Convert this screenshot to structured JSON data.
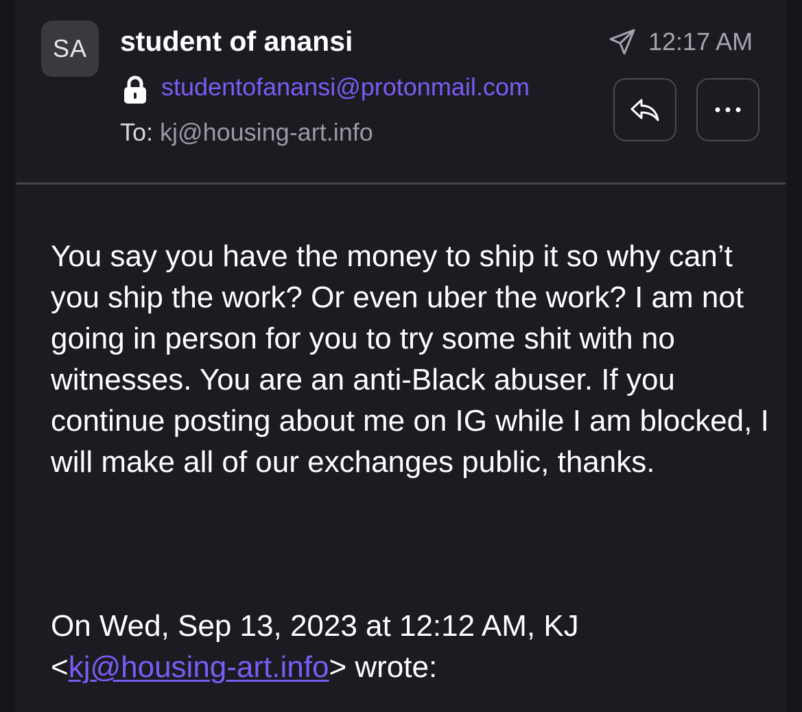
{
  "header": {
    "avatar_initials": "SA",
    "sender_name": "student of anansi",
    "sender_email": "studentofanansi@protonmail.com",
    "to_label": "To:",
    "to_address": "kj@housing-art.info",
    "timestamp": "12:17 AM",
    "icons": {
      "lock": "lock-icon",
      "sent": "paper-plane-icon",
      "reply": "reply-icon",
      "more": "more-horizontal-icon"
    }
  },
  "message": {
    "body": "You say you have the money to ship it so why can’t you ship the work? Or even uber the work? I am not going in person for you to try some shit with no witnesses. You are an anti-Black abuser. If you continue posting about me on IG while I am blocked, I will make all of our exchanges public, thanks.",
    "quote": {
      "prefix": "On Wed, Sep 13, 2023 at 12:12 AM, KJ",
      "open_bracket": "<",
      "link": "kj@housing-art.info",
      "suffix": "> wrote:"
    }
  },
  "colors": {
    "background": "#1c1b22",
    "accent": "#7b5cf5",
    "secondary_text": "#9b9aa3",
    "divider": "#46454c"
  }
}
